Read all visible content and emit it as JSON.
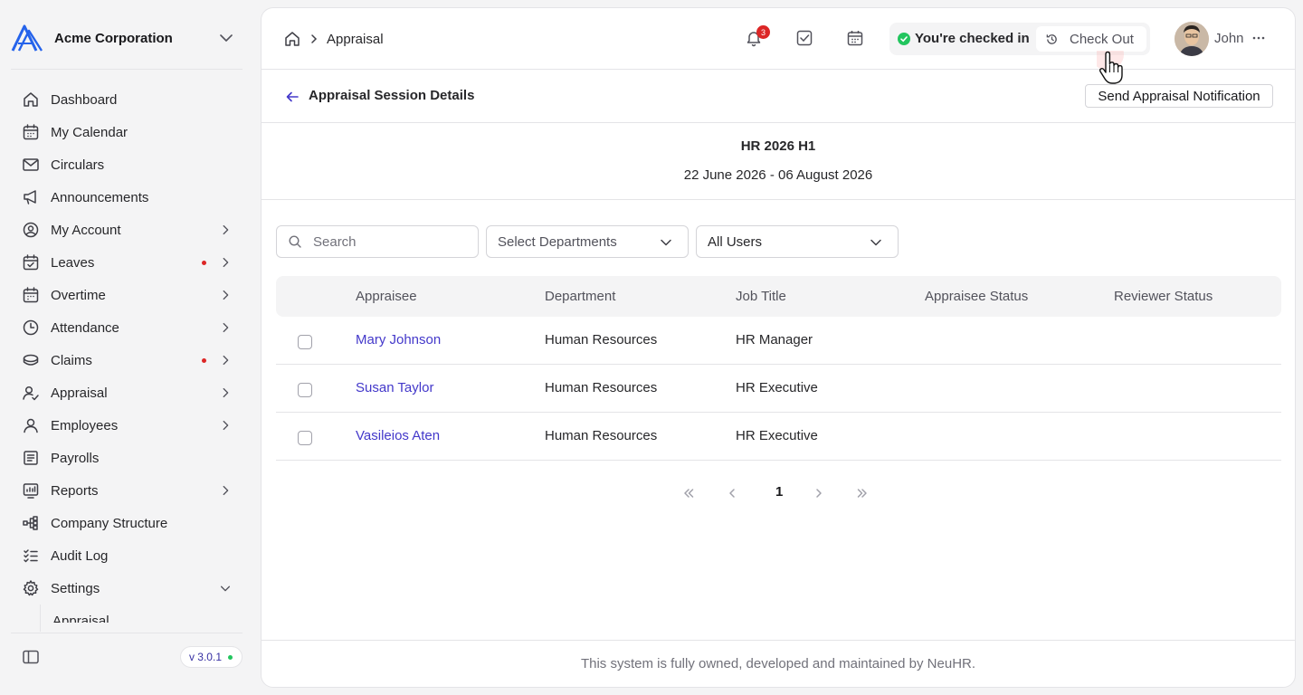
{
  "org": {
    "name": "Acme Corporation"
  },
  "sidebar": {
    "items": [
      {
        "label": "Dashboard",
        "icon": "home-icon",
        "chevron": false,
        "dot": false
      },
      {
        "label": "My Calendar",
        "icon": "calendar-icon",
        "chevron": false,
        "dot": false
      },
      {
        "label": "Circulars",
        "icon": "mail-icon",
        "chevron": false,
        "dot": false
      },
      {
        "label": "Announcements",
        "icon": "megaphone-icon",
        "chevron": false,
        "dot": false
      },
      {
        "label": "My Account",
        "icon": "user-circle-icon",
        "chevron": true,
        "dot": false
      },
      {
        "label": "Leaves",
        "icon": "calendar-check-icon",
        "chevron": true,
        "dot": true
      },
      {
        "label": "Overtime",
        "icon": "calendar-clock-icon",
        "chevron": true,
        "dot": false
      },
      {
        "label": "Attendance",
        "icon": "clock-icon",
        "chevron": true,
        "dot": false
      },
      {
        "label": "Claims",
        "icon": "coins-icon",
        "chevron": true,
        "dot": true
      },
      {
        "label": "Appraisal",
        "icon": "user-check-icon",
        "chevron": true,
        "dot": false
      },
      {
        "label": "Employees",
        "icon": "user-icon",
        "chevron": true,
        "dot": false
      },
      {
        "label": "Payrolls",
        "icon": "receipt-icon",
        "chevron": false,
        "dot": false
      },
      {
        "label": "Reports",
        "icon": "chart-icon",
        "chevron": true,
        "dot": false
      },
      {
        "label": "Company Structure",
        "icon": "structure-icon",
        "chevron": false,
        "dot": false
      },
      {
        "label": "Audit Log",
        "icon": "list-check-icon",
        "chevron": false,
        "dot": false
      },
      {
        "label": "Settings",
        "icon": "gear-icon",
        "chevron": "down",
        "dot": false
      }
    ],
    "sub_item_partial": "Appraisal",
    "version": "v 3.0.1"
  },
  "header": {
    "breadcrumb": "Appraisal",
    "notification_count": "3",
    "checkin_status": "You're checked in",
    "checkout_label": "Check Out",
    "user_name": "John"
  },
  "page": {
    "title": "Appraisal Session Details",
    "send_button": "Send Appraisal Notification"
  },
  "session": {
    "name": "HR 2026 H1",
    "dates": "22 June 2026 - 06 August 2026"
  },
  "filters": {
    "search_placeholder": "Search",
    "departments": "Select Departments",
    "users": "All Users"
  },
  "table": {
    "headers": [
      "Appraisee",
      "Department",
      "Job Title",
      "Appraisee Status",
      "Reviewer Status"
    ],
    "rows": [
      {
        "appraisee": "Mary Johnson",
        "department": "Human Resources",
        "job_title": "HR Manager",
        "appraisee_status": "",
        "reviewer_status": ""
      },
      {
        "appraisee": "Susan Taylor",
        "department": "Human Resources",
        "job_title": "HR Executive",
        "appraisee_status": "",
        "reviewer_status": ""
      },
      {
        "appraisee": "Vasileios Aten",
        "department": "Human Resources",
        "job_title": "HR Executive",
        "appraisee_status": "",
        "reviewer_status": ""
      }
    ]
  },
  "pagination": {
    "current": "1"
  },
  "footer": {
    "text": "This system is fully owned, developed and maintained by NeuHR."
  },
  "colors": {
    "accent": "#4338ca",
    "badge": "#dc2626",
    "online": "#22c55e",
    "logo": "#2563eb"
  }
}
